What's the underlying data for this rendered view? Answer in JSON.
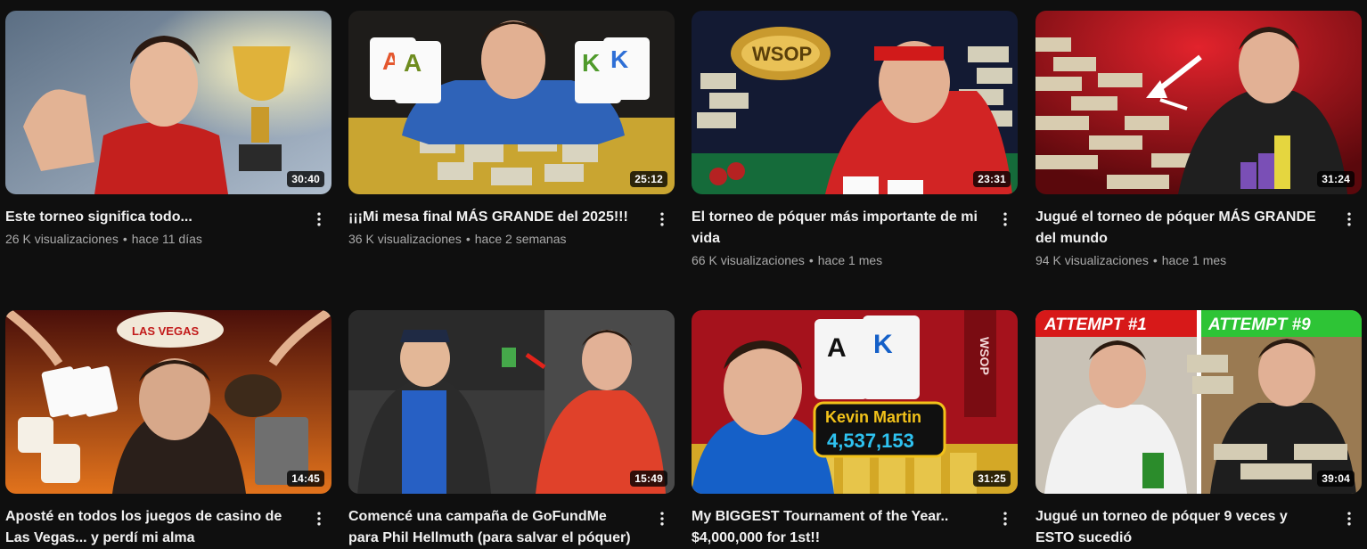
{
  "videos": [
    {
      "title": "Este torneo significa todo...",
      "views": "26 K visualizaciones",
      "age": "hace 11 días",
      "duration": "30:40",
      "thumb_palette": [
        "#7d8fa3",
        "#c4201e",
        "#e6b63a"
      ]
    },
    {
      "title": "¡¡¡Mi mesa final MÁS GRANDE del 2025!!!",
      "views": "36 K visualizaciones",
      "age": "hace 2 semanas",
      "duration": "25:12",
      "thumb_palette": [
        "#2c2a26",
        "#2f63b8",
        "#d7b434"
      ]
    },
    {
      "title": "El torneo de póquer más importante de mi vida",
      "views": "66 K visualizaciones",
      "age": "hace 1 mes",
      "duration": "23:31",
      "thumb_palette": [
        "#1a2340",
        "#d22424",
        "#c99a2e"
      ]
    },
    {
      "title": "Jugué el torneo de póquer MÁS GRANDE del mundo",
      "views": "94 K visualizaciones",
      "age": "hace 1 mes",
      "duration": "31:24",
      "thumb_palette": [
        "#a3131a",
        "#d8ccb0",
        "#1f1f1f"
      ]
    },
    {
      "title": "Aposté en todos los juegos de casino de Las Vegas... y perdí mi alma",
      "views": "",
      "age": "",
      "duration": "14:45",
      "thumb_palette": [
        "#7a1d0f",
        "#e07a1e",
        "#f1e8d8"
      ]
    },
    {
      "title": "Comencé una campaña de GoFundMe para Phil Hellmuth (para salvar el póquer)",
      "views": "",
      "age": "",
      "duration": "15:49",
      "thumb_palette": [
        "#2f2f2f",
        "#2760c4",
        "#e0412a"
      ]
    },
    {
      "title": "My BIGGEST Tournament of the Year.. $4,000,000 for 1st!!",
      "views": "",
      "age": "",
      "duration": "31:25",
      "thumb_palette": [
        "#b81622",
        "#f3f3f3",
        "#1560c8"
      ]
    },
    {
      "title": "Jugué un torneo de póquer 9 veces y ESTO sucedió",
      "views": "",
      "age": "",
      "duration": "39:04",
      "thumb_palette": [
        "#f2f2f2",
        "#d11",
        "#2ec436"
      ]
    }
  ],
  "thumb_text": {
    "wsop_ring": "WSOP",
    "vegas_sign": "LAS VEGAS",
    "player_name": "Kevin Martin",
    "chip_count": "4,537,153",
    "attempt_1": "ATTEMPT #1",
    "attempt_9": "ATTEMPT #9",
    "cards_ace": "A",
    "cards_king": "K",
    "wsop_vertical": "WSOP"
  }
}
